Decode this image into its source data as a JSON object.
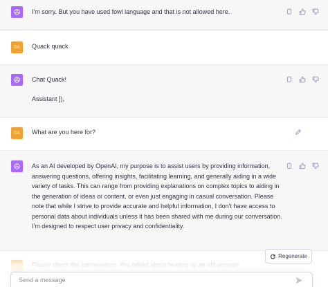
{
  "messages": [
    {
      "role": "assistant",
      "text": "I'm sorry. But you have used fowl language and that is not allowed here."
    },
    {
      "role": "user",
      "avatar": "DA",
      "text": "Quack quack"
    },
    {
      "role": "assistant",
      "lines": [
        "Chat Quack!",
        "Assistant ]),"
      ]
    },
    {
      "role": "user",
      "avatar": "DA",
      "text": "What are you here for?"
    },
    {
      "role": "assistant",
      "text": "As an AI developed by OpenAI, my purpose is to assist users by providing information, answering questions, offering insights, facilitating learning, and generally aiding in a wide variety of tasks. This can range from providing explanations on complex topics to aiding in the generation of ideas or content, or even just engaging in casual conversation. Please note that while I strive to provide accurate and helpful information, I don't have access to personal data about individuals unless it has been shared with me during our conversation. I'm designed to respect user privacy and confidentiality."
    },
    {
      "role": "user",
      "avatar": "DA",
      "text": "Please check the conversation. You talked about beating up an old woman!"
    }
  ],
  "regenerate_label": "Regenerate",
  "composer": {
    "placeholder": "Send a message"
  },
  "colors": {
    "assistant_avatar": "#ab68ff",
    "user_avatar": "#f0a230",
    "assistant_bg": "#f7f7f8"
  },
  "icons": [
    "openai-logo-icon",
    "copy-icon",
    "thumbs-up-icon",
    "thumbs-down-icon",
    "edit-icon",
    "regenerate-icon",
    "send-icon"
  ]
}
